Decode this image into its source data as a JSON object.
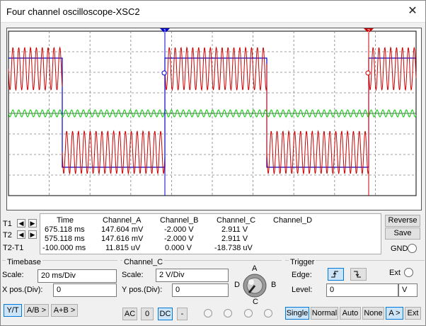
{
  "window": {
    "title": "Four channel oscilloscope-XSC2",
    "close_glyph": "✕"
  },
  "cursors": {
    "t1_label": "1",
    "t2_label": "2"
  },
  "readout": {
    "row_labels": [
      "T1",
      "T2",
      "T2-T1"
    ],
    "headers": [
      "Time",
      "Channel_A",
      "Channel_B",
      "Channel_C",
      "Channel_D"
    ],
    "rows": [
      [
        "675.118 ms",
        "147.604 mV",
        "-2.000 V",
        "2.911 V",
        ""
      ],
      [
        "575.118 ms",
        "147.616 mV",
        "-2.000 V",
        "2.911 V",
        ""
      ],
      [
        "-100.000 ms",
        "11.815 uV",
        "0.000 V",
        "-18.738 uV",
        ""
      ]
    ]
  },
  "side": {
    "reverse": "Reverse",
    "save": "Save",
    "gnd": "GND"
  },
  "timebase": {
    "title": "Timebase",
    "scale_label": "Scale:",
    "scale_value": "20 ms/Div",
    "xpos_label": "X pos.(Div):",
    "xpos_value": "0",
    "modes": [
      "Y/T",
      "A/B >",
      "A+B >"
    ]
  },
  "channel": {
    "title": "Channel_C",
    "scale_label": "Scale:",
    "scale_value": "2  V/Div",
    "ypos_label": "Y pos.(Div):",
    "ypos_value": "0",
    "coupling": [
      "AC",
      "0",
      "DC",
      "-"
    ],
    "dial_labels": [
      "A",
      "B",
      "C",
      "D"
    ]
  },
  "trigger": {
    "title": "Trigger",
    "edge_label": "Edge:",
    "ext_label": "Ext",
    "level_label": "Level:",
    "level_value": "0",
    "level_unit": "V",
    "modes": [
      "Single",
      "Normal",
      "Auto",
      "None",
      "A >",
      "Ext"
    ]
  },
  "colors": {
    "grid": "#808080",
    "channel_a": "#cc0000",
    "channel_b": "#0000cc",
    "channel_c": "#00cc00",
    "cursor_1": "#0000cc",
    "cursor_2": "#cc0000"
  }
}
